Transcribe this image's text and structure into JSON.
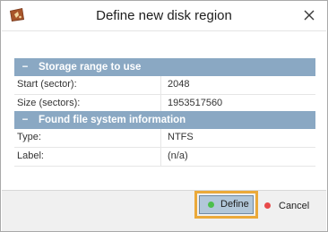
{
  "window": {
    "title": "Define new disk region",
    "icons": {
      "app": "disk-app-icon",
      "close": "close-icon"
    }
  },
  "groups": [
    {
      "toggle": "−",
      "title": "Storage range to use",
      "rows": [
        {
          "key": "Start (sector):",
          "value": "2048"
        },
        {
          "key": "Size (sectors):",
          "value": "1953517560"
        }
      ]
    },
    {
      "toggle": "−",
      "title": "Found file system information",
      "rows": [
        {
          "key": "Type:",
          "value": "NTFS"
        },
        {
          "key": "Label:",
          "value": "(n/a)"
        }
      ]
    }
  ],
  "footer": {
    "define_label": "Define",
    "cancel_label": "Cancel"
  },
  "colors": {
    "group_header": "#8aa8c3",
    "define_button": "#b2c7d9",
    "highlight": "#eaa93a",
    "define_dot": "#4bbf4b",
    "cancel_dot": "#e84a4a"
  }
}
